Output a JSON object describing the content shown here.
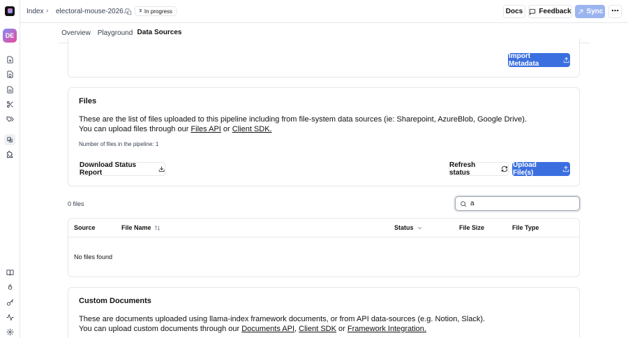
{
  "rail": {
    "avatar": "DE",
    "top_icons": [
      "file-plus-icon",
      "file-sync-icon",
      "file-text-icon",
      "scissors-icon",
      "tags-icon",
      "data-sources-icon",
      "puzzle-icon"
    ],
    "bottom_icons": [
      "book-icon",
      "flame-icon",
      "key-icon",
      "activity-icon",
      "settings-icon"
    ]
  },
  "topbar": {
    "breadcrumb_index": "Index",
    "breadcrumb_pipeline": "electoral-mouse-2026...",
    "status_badge": "In progress",
    "docs_label": "Docs",
    "feedback_label": "Feedback",
    "sync_label": "Sync"
  },
  "tabs": [
    {
      "label": "Overview",
      "active": false
    },
    {
      "label": "Playground",
      "active": false
    },
    {
      "label": "Data Sources",
      "active": true
    }
  ],
  "metadata_card": {
    "import_label": "Import Metadata"
  },
  "files_card": {
    "title": "Files",
    "desc_line1": "These are the list of files uploaded to this pipeline including from file-system data sources (ie: Sharepoint, AzureBlob, Google Drive).",
    "desc_line2_prefix": "You can upload files through our ",
    "files_api_link": "Files API",
    "or_text": " or ",
    "client_sdk_link": "Client SDK.",
    "count_text": "Number of files in the pipeline: 1",
    "download_label": "Download Status Report",
    "refresh_label": "Refresh status",
    "upload_label": "Upload File(s)"
  },
  "files_list": {
    "count_label": "0 files",
    "search_value": "a",
    "columns": [
      "Source",
      "File Name",
      "Status",
      "File Size",
      "File Type"
    ],
    "empty_text": "No files found"
  },
  "custom_docs": {
    "title": "Custom Documents",
    "desc_line1": "These are documents uploaded using llama-index framework documents, or from API data-sources (e.g. Notion, Slack).",
    "desc_line2_prefix": "You can upload custom documents through our ",
    "documents_api_link": "Documents API",
    "comma": ", ",
    "client_sdk_link": "Client SDK",
    "or_text": " or ",
    "framework_link": "Framework Integration."
  }
}
